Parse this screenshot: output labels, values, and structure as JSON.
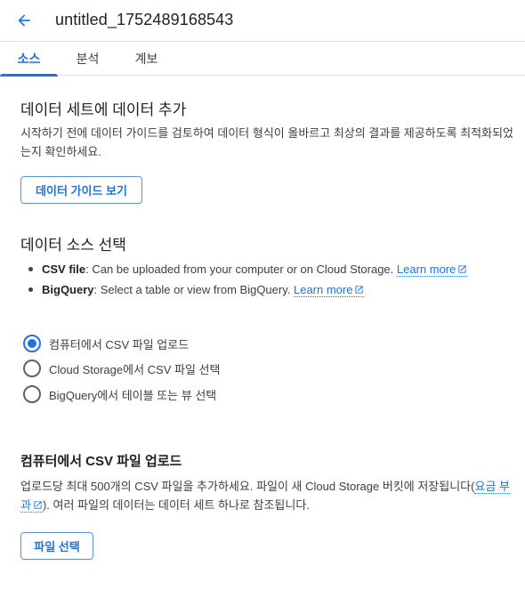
{
  "header": {
    "back_icon": "arrow-back-icon",
    "title": "untitled_1752489168543"
  },
  "tabs": [
    {
      "label": "소스",
      "active": true
    },
    {
      "label": "분석",
      "active": false
    },
    {
      "label": "계보",
      "active": false
    }
  ],
  "add_data": {
    "heading": "데이터 세트에 데이터 추가",
    "description": "시작하기 전에 데이터 가이드를 검토하여 데이터 형식이 올바르고 최상의 결과를 제공하도록 최적화되었는지 확인하세요.",
    "guide_button": "데이터 가이드 보기"
  },
  "source_select": {
    "heading": "데이터 소스 선택",
    "bullets": [
      {
        "bold": "CSV file",
        "text": ": Can be uploaded from your computer or on Cloud Storage. ",
        "link": "Learn more"
      },
      {
        "bold": "BigQuery",
        "text": ": Select a table or view from BigQuery. ",
        "link": "Learn more"
      }
    ],
    "options": [
      {
        "label": "컴퓨터에서 CSV 파일 업로드",
        "checked": true
      },
      {
        "label": "Cloud Storage에서 CSV 파일 선택",
        "checked": false
      },
      {
        "label": "BigQuery에서 테이블 또는 뷰 선택",
        "checked": false
      }
    ]
  },
  "upload": {
    "heading": "컴퓨터에서 CSV 파일 업로드",
    "desc_before": "업로드당 최대 500개의 CSV 파일을 추가하세요. 파일이 새 Cloud Storage 버킷에 저장됩니다(",
    "desc_link": "요금 부과",
    "desc_after": "). 여러 파일의 데이터는 데이터 세트 하나로 참조됩니다.",
    "select_button": "파일 선택"
  },
  "colors": {
    "accent": "#1a73e8",
    "text": "#202124",
    "secondary_text": "#3c4043",
    "divider": "#e0e0e0"
  }
}
